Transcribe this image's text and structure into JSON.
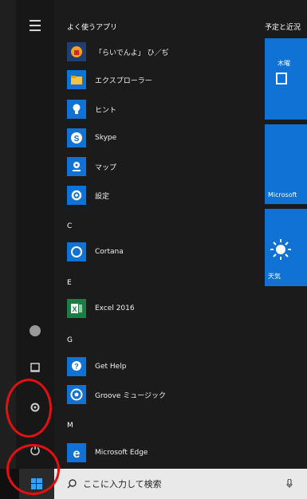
{
  "start_menu": {
    "sections": {
      "frequent": "よく使うアプリ",
      "c": "C",
      "e": "E",
      "g": "G",
      "m": "M"
    },
    "apps": [
      {
        "label": "「らいでんよ」 ひ／ぢ",
        "icon": "app-icon"
      },
      {
        "label": "エクスプローラー",
        "icon": "file-explorer-icon"
      },
      {
        "label": "ヒント",
        "icon": "tips-lightbulb-icon"
      },
      {
        "label": "Skype",
        "icon": "skype-icon"
      },
      {
        "label": "マップ",
        "icon": "maps-icon"
      },
      {
        "label": "設定",
        "icon": "settings-gear-icon"
      },
      {
        "label": "Cortana",
        "icon": "cortana-icon"
      },
      {
        "label": "Excel 2016",
        "icon": "excel-icon"
      },
      {
        "label": "Get Help",
        "icon": "get-help-icon"
      },
      {
        "label": "Groove ミュージック",
        "icon": "groove-music-icon"
      },
      {
        "label": "Microsoft Edge",
        "icon": "edge-icon"
      }
    ],
    "tiles_header": "予定と近況",
    "tiles": [
      {
        "label": "",
        "top_text": "木曜"
      },
      {
        "label": "Microsoft",
        "top_text": ""
      },
      {
        "label": "天気",
        "top_text": ""
      }
    ]
  },
  "taskbar": {
    "search_placeholder": "ここに入力して検索"
  },
  "colors": {
    "tile_blue": "#0f72d4",
    "annotation_red": "#e21010"
  }
}
